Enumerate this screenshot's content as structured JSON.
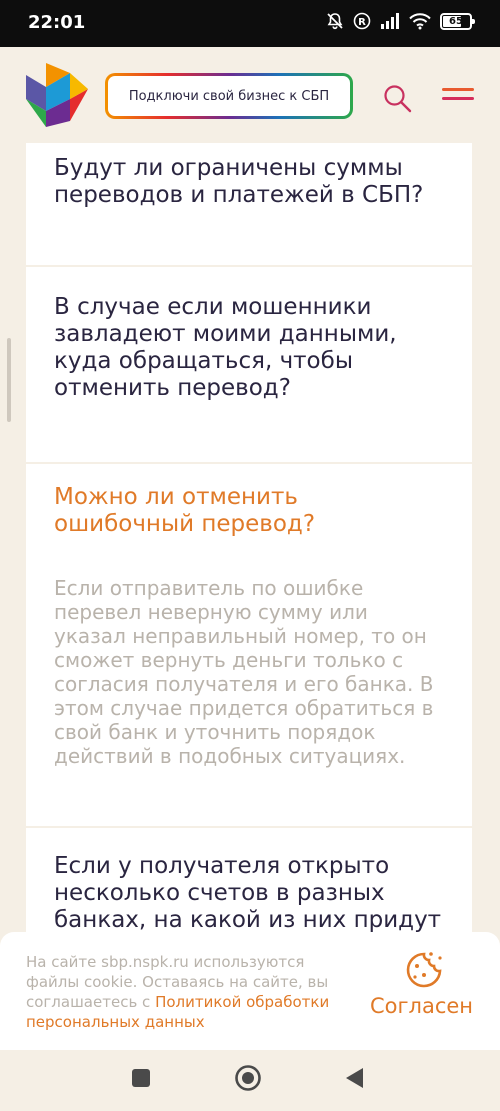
{
  "status_bar": {
    "time": "22:01",
    "battery": "65",
    "icons": [
      "mute-icon",
      "registered-icon",
      "signal-icon",
      "wifi-icon",
      "battery-icon"
    ]
  },
  "header": {
    "cta_label": "Подключи свой бизнес к СБП",
    "logo": "sbp-logo",
    "search_icon": "search-icon",
    "menu_icon": "menu-icon"
  },
  "faq": [
    {
      "question": "Будут ли ограничены суммы переводов и платежей в СБП?"
    },
    {
      "question": "В случае если мошенники завладеют моими данными, куда обращаться, чтобы отменить перевод?"
    },
    {
      "question": "Можно ли отменить ошибочный перевод?",
      "answer": "Если отправитель по ошибке перевел неверную сумму или указал неправильный номер, то он сможет вернуть деньги только с согласия получателя и его банка. В этом случае придется обратиться в свой банк и уточнить порядок действий в подобных ситуациях."
    },
    {
      "question": "Если у получателя открыто несколько счетов в разных банках, на какой из них придут"
    }
  ],
  "cookie": {
    "text": "На сайте sbp.nspk.ru используются файлы cookie. Оставаясь на сайте, вы соглашаетесь с ",
    "link": "Политикой обработки персональных данных",
    "agree_label": "Согласен"
  },
  "colors": {
    "accent": "#e07a28",
    "background": "#f5efe5",
    "text": "#2a2540",
    "muted": "#b9b3ab"
  }
}
